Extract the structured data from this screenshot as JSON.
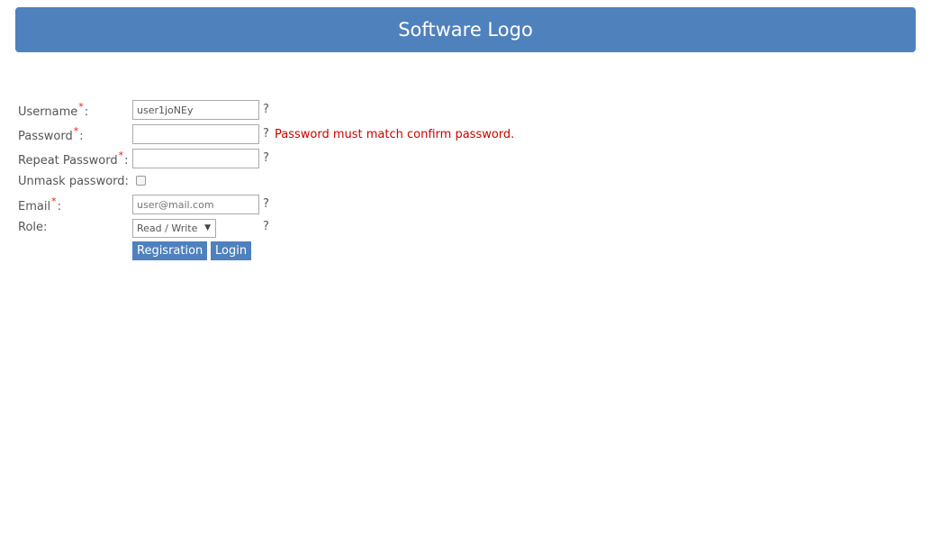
{
  "header": {
    "title": "Software Logo"
  },
  "form": {
    "required_mark": "*",
    "help_mark": "?",
    "username": {
      "label": "Username",
      "value": "user1joNEy"
    },
    "password": {
      "label": "Password",
      "value": "",
      "error": "Password must match confirm password."
    },
    "repeat_password": {
      "label": "Repeat Password",
      "value": ""
    },
    "unmask": {
      "label": "Unmask password:",
      "checked": false
    },
    "email": {
      "label": "Email",
      "placeholder": "user@mail.com"
    },
    "role": {
      "label": "Role:",
      "selected": "Read / Write",
      "arrow": "▼"
    },
    "buttons": {
      "register": "Regisration",
      "login": "Login"
    }
  },
  "colors": {
    "accent": "#4f81bd",
    "error": "#cc0000",
    "required": "#e02020"
  }
}
